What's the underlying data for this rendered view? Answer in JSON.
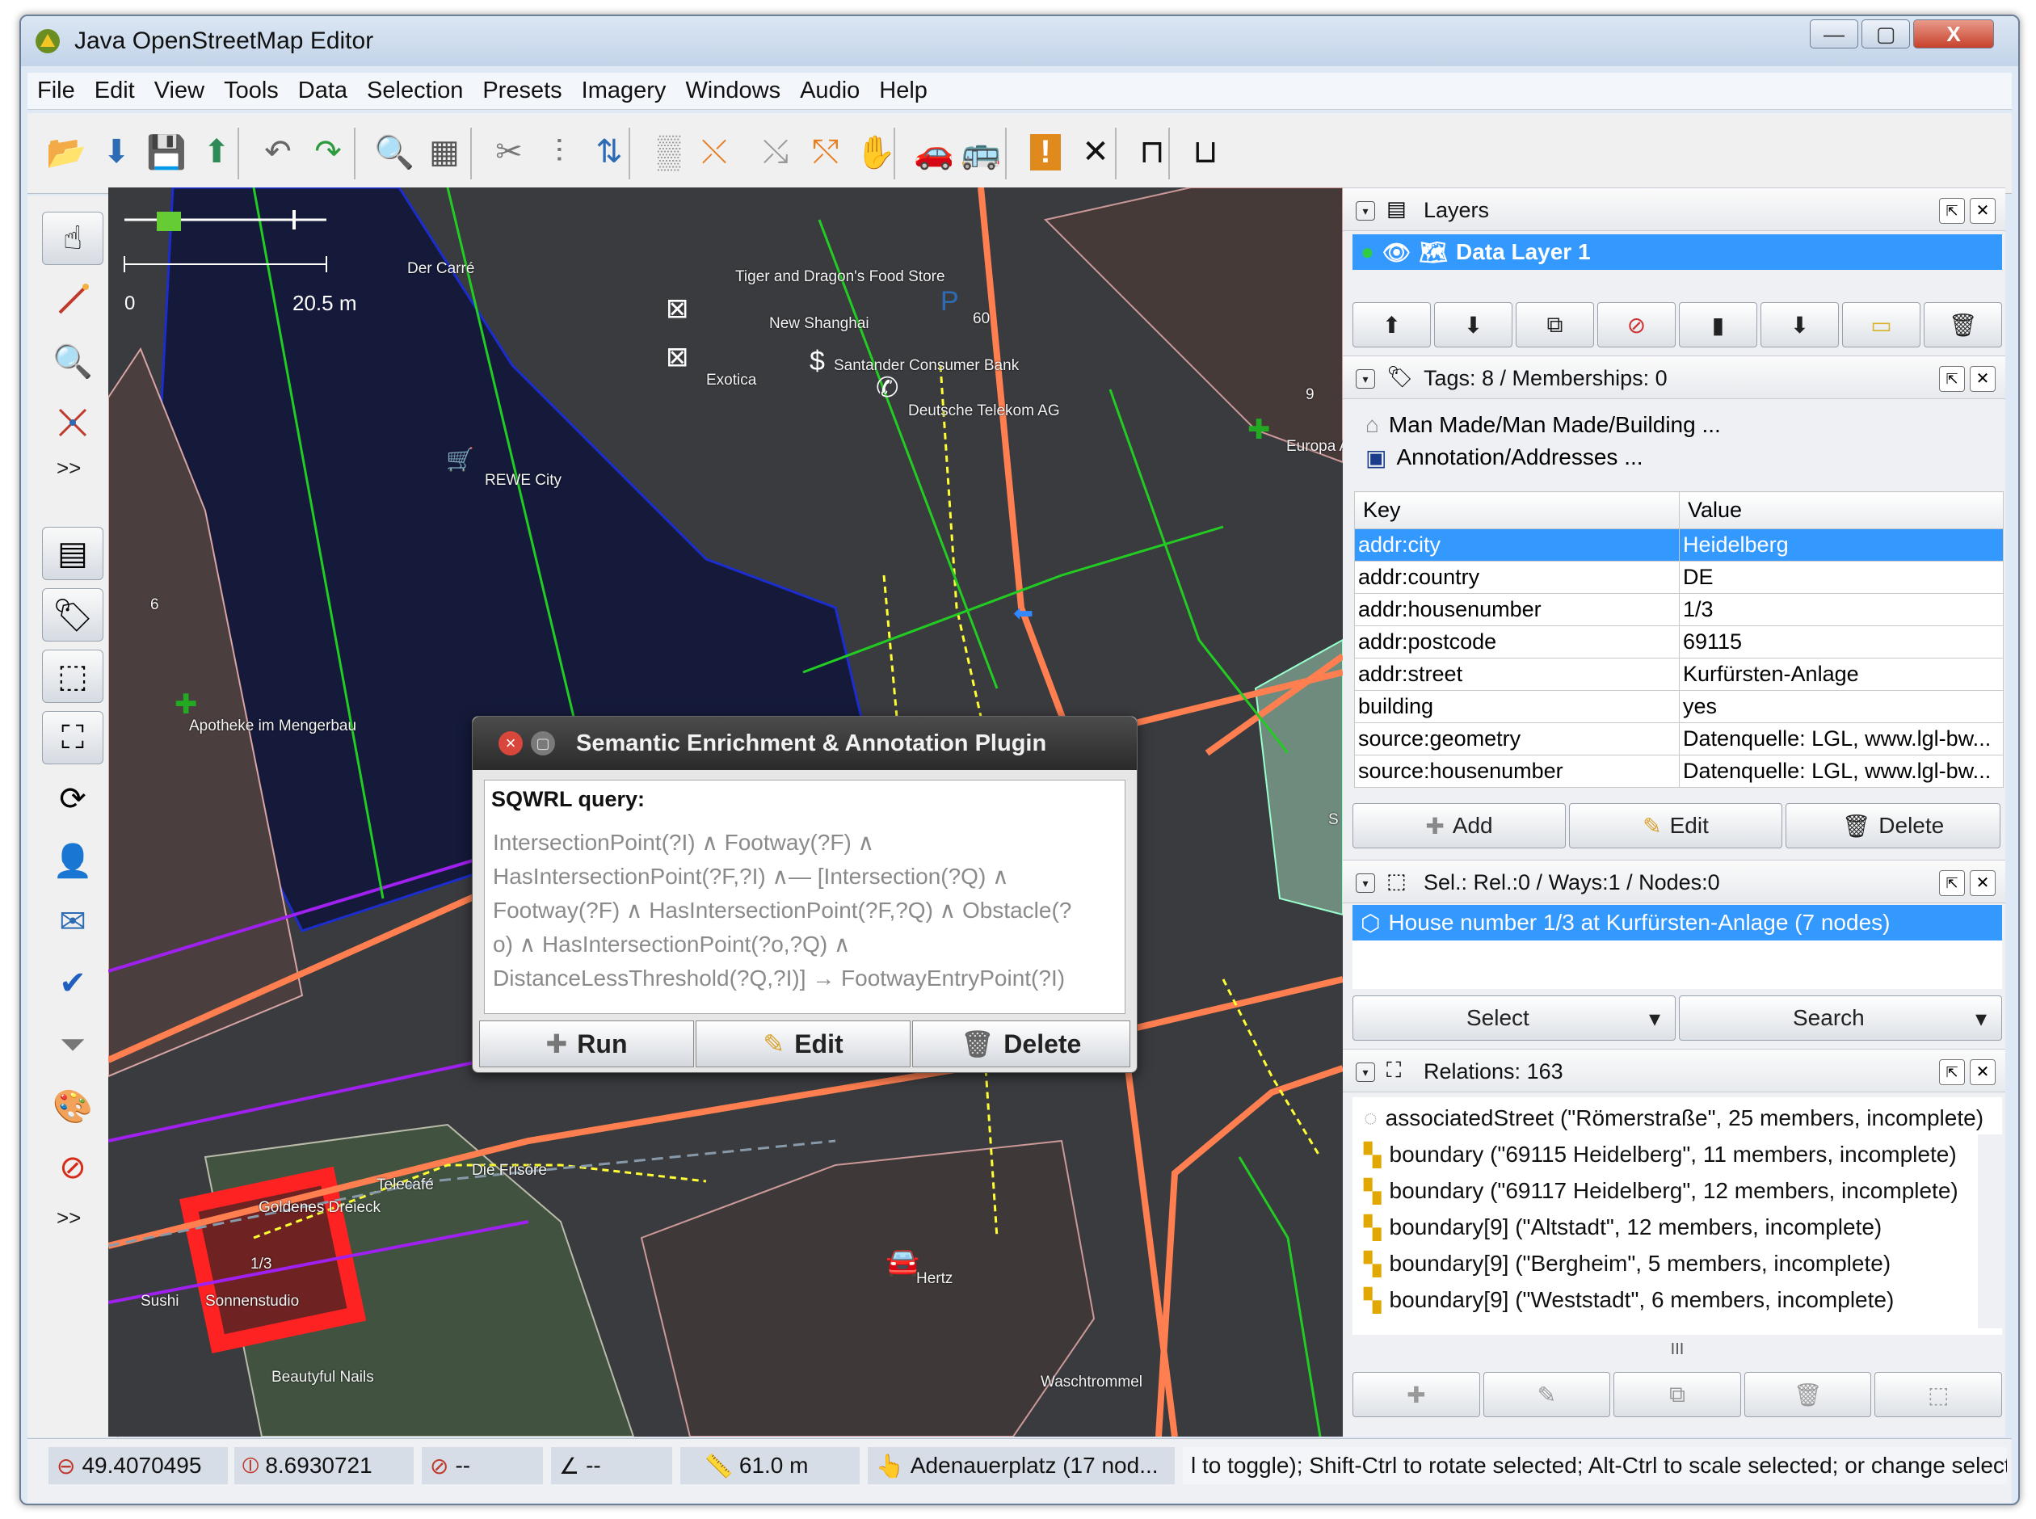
{
  "window": {
    "title": "Java OpenStreetMap Editor",
    "minimize": "—",
    "maximize": "▢",
    "close": "X"
  },
  "menu": [
    "File",
    "Edit",
    "View",
    "Tools",
    "Data",
    "Selection",
    "Presets",
    "Imagery",
    "Windows",
    "Audio",
    "Help"
  ],
  "toolbar_icons": [
    "open-file-icon",
    "download-icon",
    "save-icon",
    "upload-icon",
    "undo-icon",
    "redo-icon",
    "preferences-icon",
    "zoom-data-icon",
    "delete-icon",
    "combine-way-icon",
    "split-way-icon",
    "reverse-way-icon",
    "wireframe-icon",
    "align-circle-icon",
    "align-line-icon",
    "hand-icon",
    "car-icon",
    "bus-icon",
    "warning-icon",
    "cross-icon",
    "bridge-icon",
    "tunnel-icon"
  ],
  "left_tools": {
    "more_label": ">>"
  },
  "map": {
    "scale_labels": [
      "0",
      "20.5 m"
    ],
    "labels": [
      "Der Carré",
      "Tiger and Dragon's Food Store",
      "New Shanghai",
      "Exotica",
      "60",
      "Santander Consumer Bank",
      "Deutsche Telekom AG",
      "REWE City",
      "6",
      "9",
      "Europa Ap",
      "Apotheke im Mengerbau",
      "Goldenes Dreieck",
      "1/3",
      "Sushi",
      "Sonnenstudio",
      "Beautyful Nails",
      "Telecafé",
      "Die Frisöre",
      "Hertz",
      "Waschtrommel",
      "S"
    ]
  },
  "dialog": {
    "close": "×",
    "title": "Semantic Enrichment & Annotation Plugin",
    "query_label": "SQWRL query:",
    "query_lines": [
      "IntersectionPoint(?I) ∧ Footway(?F) ∧",
      "HasIntersectionPoint(?F,?I) ∧— [Intersection(?Q) ∧",
      "Footway(?F) ∧ HasIntersectionPoint(?F,?Q) ∧ Obstacle(?",
      "o) ∧ HasIntersectionPoint(?o,?Q) ∧",
      "DistanceLessThreshold(?Q,?I)] → FootwayEntryPoint(?I)"
    ],
    "buttons": {
      "run": "Run",
      "edit": "Edit",
      "delete": "Delete"
    }
  },
  "layers_panel": {
    "title": "Layers",
    "active_layer": "Data Layer 1"
  },
  "tags_panel": {
    "title": "Tags: 8 / Memberships: 0",
    "presets": [
      "Man Made/Man Made/Building ...",
      "Annotation/Addresses ..."
    ],
    "headers": {
      "key": "Key",
      "value": "Value"
    },
    "rows": [
      {
        "key": "addr:city",
        "value": "Heidelberg"
      },
      {
        "key": "addr:country",
        "value": "DE"
      },
      {
        "key": "addr:housenumber",
        "value": "1/3"
      },
      {
        "key": "addr:postcode",
        "value": "69115"
      },
      {
        "key": "addr:street",
        "value": "Kurfürsten-Anlage"
      },
      {
        "key": "building",
        "value": "yes"
      },
      {
        "key": "source:geometry",
        "value": "Datenquelle: LGL, www.lgl-bw..."
      },
      {
        "key": "source:housenumber",
        "value": "Datenquelle: LGL, www.lgl-bw..."
      }
    ],
    "buttons": {
      "add": "Add",
      "edit": "Edit",
      "delete": "Delete"
    }
  },
  "selection_panel": {
    "title": "Sel.: Rel.:0 / Ways:1 / Nodes:0",
    "item": "House number 1/3 at Kurfürsten-Anlage (7 nodes)",
    "buttons": {
      "select": "Select",
      "search": "Search"
    }
  },
  "relations_panel": {
    "title": "Relations: 163",
    "items": [
      "associatedStreet (\"Römerstraße\", 25 members, incomplete)",
      "boundary (\"69115 Heidelberg\", 11 members, incomplete)",
      "boundary (\"69117 Heidelberg\", 12 members, incomplete)",
      "boundary[9] (\"Altstadt\", 12 members, incomplete)",
      "boundary[9] (\"Bergheim\", 5 members, incomplete)",
      "boundary[9] (\"Weststadt\", 6 members, incomplete)"
    ],
    "scroll_thumb": "III"
  },
  "status": {
    "lat": "49.4070495",
    "lon": "8.6930721",
    "heading": "--",
    "angle": "--",
    "distance": "61.0 m",
    "name": "Adenauerplatz (17 nod...",
    "help": "l to toggle); Shift-Ctrl to rotate selected; Alt-Ctrl to scale selected; or change selection"
  }
}
